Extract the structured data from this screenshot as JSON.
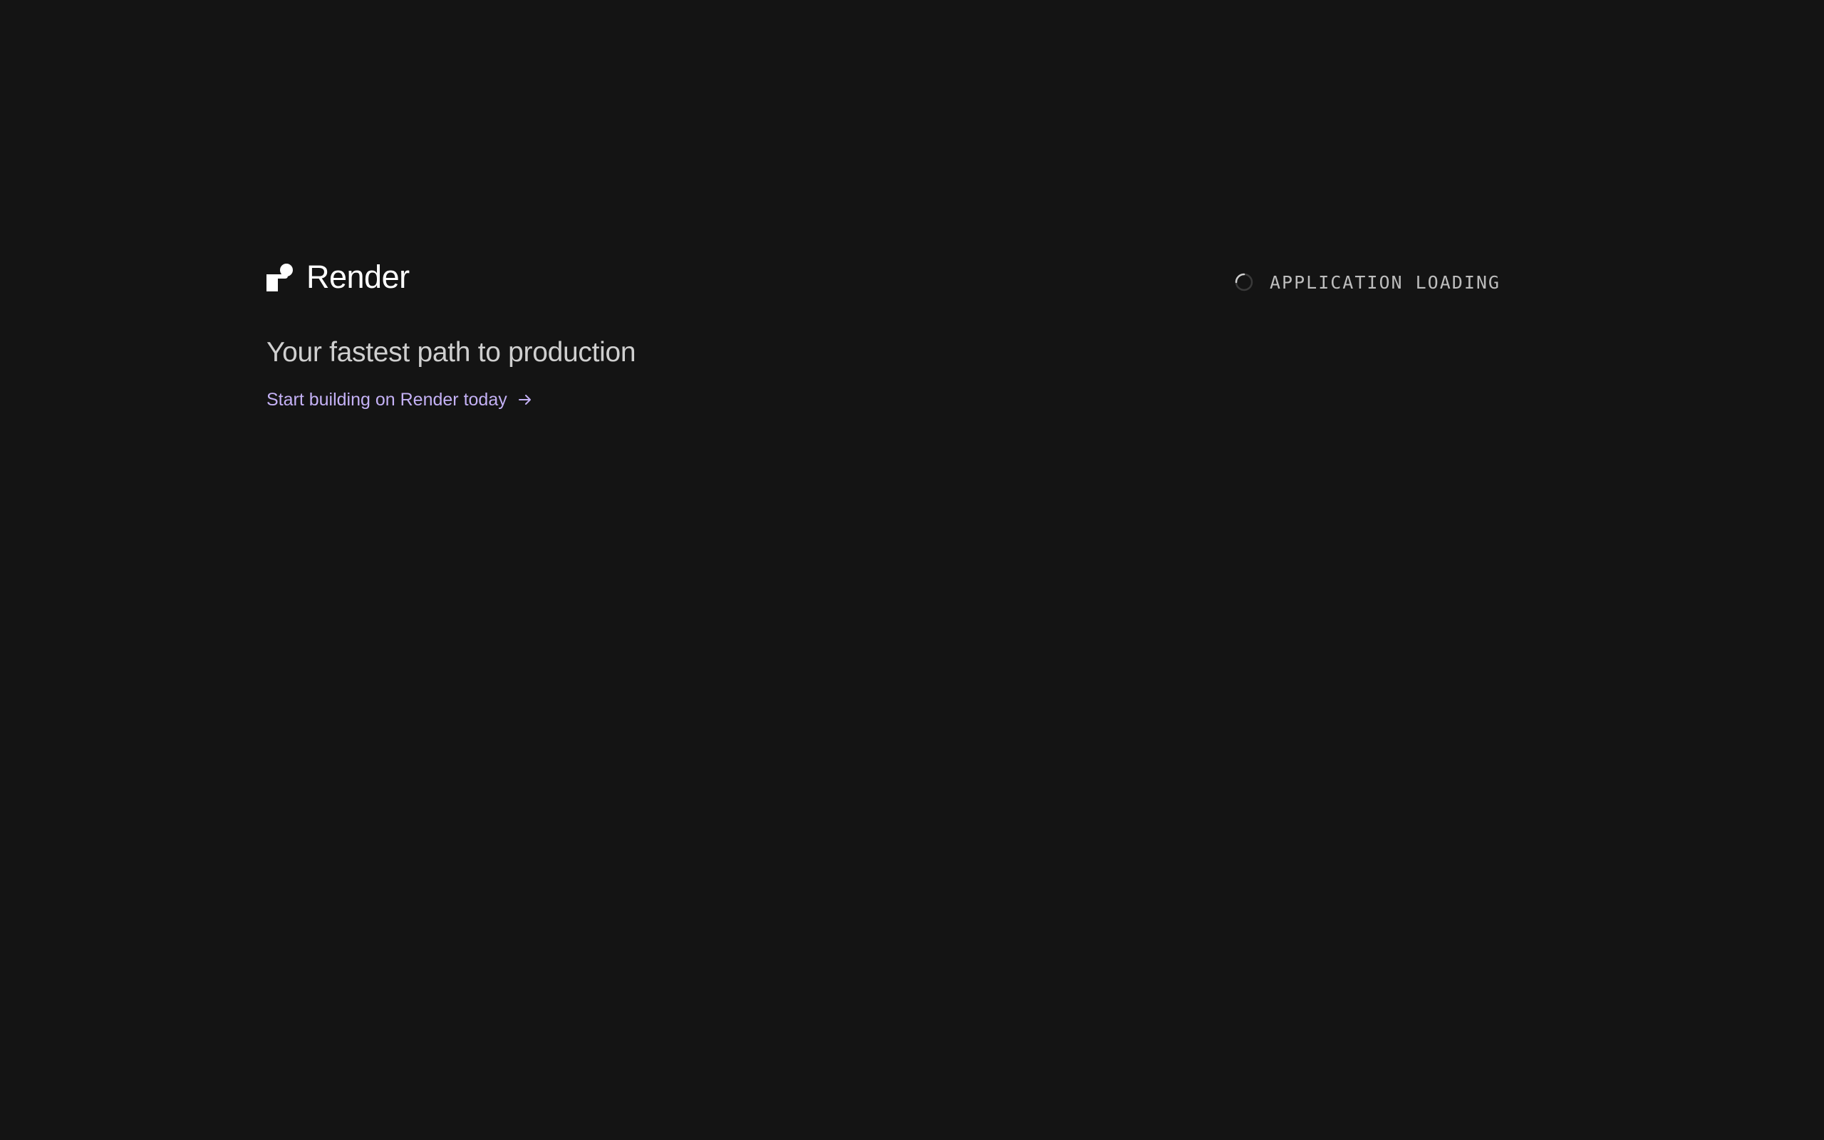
{
  "brand": {
    "name": "Render",
    "logo_icon": "render-logo-icon"
  },
  "hero": {
    "headline": "Your fastest path to production",
    "cta_label": "Start building on Render today",
    "cta_icon": "arrow-right-icon"
  },
  "status": {
    "icon": "loading-spinner-icon",
    "text": "APPLICATION LOADING"
  },
  "colors": {
    "background": "#141414",
    "brand_text": "#ffffff",
    "headline_text": "#cfcfcf",
    "link_accent": "#c4b1f5",
    "status_text": "#bdbdbd"
  }
}
